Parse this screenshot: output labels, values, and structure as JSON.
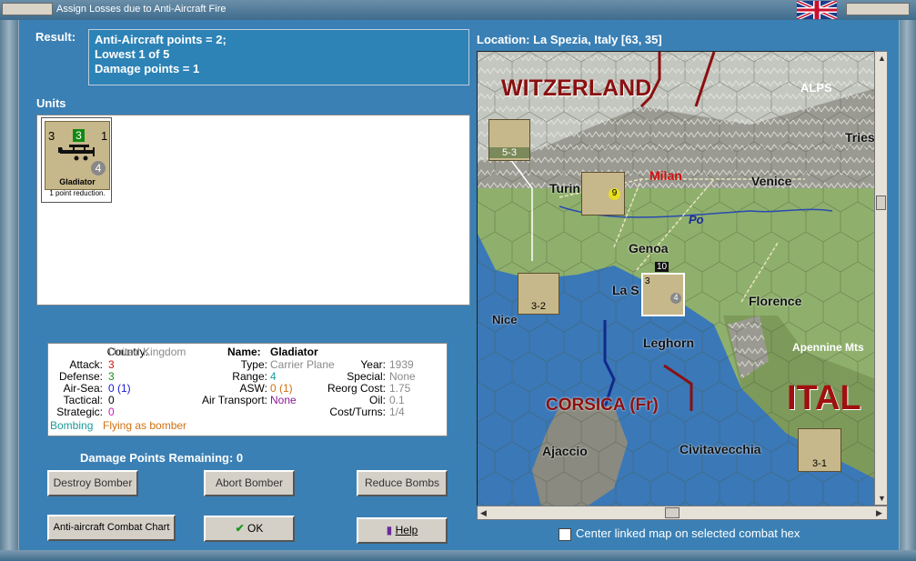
{
  "window": {
    "title": "Assign Losses due to Anti-Aircraft Fire"
  },
  "result": {
    "label": "Result:",
    "lines": [
      "Anti-Aircraft points = 2;",
      "Lowest 1 of 5",
      "Damage points = 1"
    ]
  },
  "units": {
    "label": "Units",
    "items": [
      {
        "name": "Gladiator",
        "attack": "3",
        "defense": "1",
        "range": "4",
        "strength": "3",
        "caption": "1 point reduction."
      }
    ]
  },
  "info": {
    "country_label": "Country:",
    "country": "United Kingdom",
    "attack_label": "Attack:",
    "attack": "3",
    "defense_label": "Defense:",
    "defense": "3",
    "airsea_label": "Air-Sea:",
    "airsea": "0 (1)",
    "tactical_label": "Tactical:",
    "tactical": "0",
    "strategic_label": "Strategic:",
    "strategic": "0",
    "name_label": "Name:",
    "name": "Gladiator",
    "type_label": "Type:",
    "type": "Carrier Plane",
    "range_label": "Range:",
    "range": "4",
    "asw_label": "ASW:",
    "asw": "0 (1)",
    "airtransport_label": "Air Transport:",
    "airtransport": "None",
    "year_label": "Year:",
    "year": "1939",
    "special_label": "Special:",
    "special": "None",
    "reorg_label": "Reorg Cost:",
    "reorg": "1.75",
    "oil_label": "Oil:",
    "oil": "0.1",
    "costturns_label": "Cost/Turns:",
    "costturns": "1/4",
    "role1": "Bombing",
    "role2": "Flying as bomber"
  },
  "damage": {
    "label": "Damage Points Remaining:  0"
  },
  "buttons": {
    "destroy": "Destroy Bomber",
    "abort": "Abort Bomber",
    "reduce": "Reduce Bombs",
    "chart": "Anti-aircraft Combat Chart",
    "ok": "OK",
    "help": "Help"
  },
  "location": {
    "text": "Location:  La Spezia, Italy [63, 35]"
  },
  "map": {
    "labels": [
      "WITZERLAND",
      "ALPS",
      "Tries",
      "Turin",
      "Milan",
      "Venice",
      "Po",
      "Genoa",
      "La S",
      "Florence",
      "Nice",
      "Leghorn",
      "Apennine Mts",
      "ITAL",
      "CORSICA (Fr)",
      "Ajaccio",
      "Civitavecchia"
    ],
    "unit_values": [
      "5-3",
      "9",
      "3-2",
      "3-1",
      "10",
      "3",
      "4"
    ]
  },
  "center_checkbox": {
    "label": "Center linked map on selected combat hex",
    "checked": false
  },
  "colors": {
    "background": "#3a80b5",
    "result_box": "#2d83b6",
    "sea": "#3a78b8"
  }
}
